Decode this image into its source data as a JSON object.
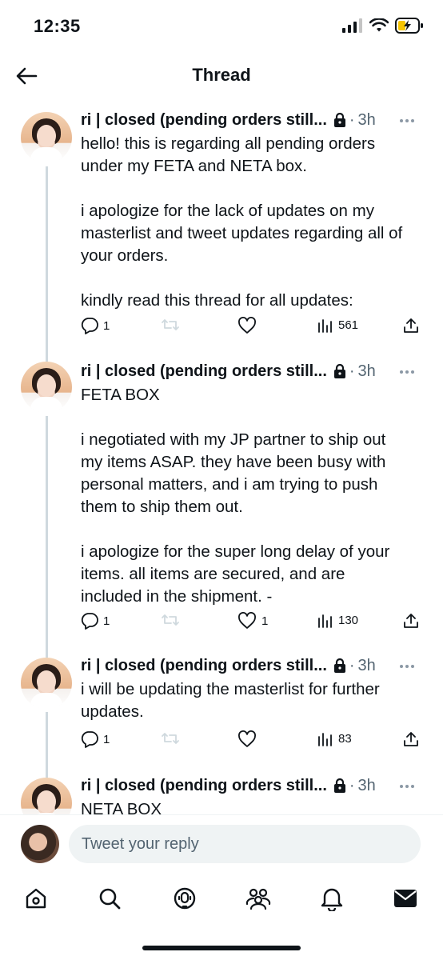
{
  "status_bar": {
    "time": "12:35"
  },
  "header": {
    "title": "Thread"
  },
  "tweets": [
    {
      "author": "ri | closed (pending orders still...",
      "time": "3h",
      "text": "hello! this is regarding all pending orders\nunder my FETA and NETA box.\n\ni apologize for the lack of updates on my\nmasterlist and tweet updates regarding all of\nyour orders.\n\nkindly read this thread for all updates:",
      "replies": "1",
      "retweets": "",
      "likes": "",
      "views": "561"
    },
    {
      "author": "ri | closed (pending orders still...",
      "time": "3h",
      "text": "FETA BOX\n\ni negotiated with my JP partner to ship out\nmy items ASAP. they have been busy with\npersonal matters, and i am trying to push\nthem to ship them out.\n\ni apologize for the super long delay of your\nitems. all items are secured, and are\nincluded in the shipment. -",
      "replies": "1",
      "retweets": "",
      "likes": "1",
      "views": "130"
    },
    {
      "author": "ri | closed (pending orders still...",
      "time": "3h",
      "text": "i will be updating the masterlist for further\nupdates.",
      "replies": "1",
      "retweets": "",
      "likes": "",
      "views": "83"
    },
    {
      "author": "ri | closed (pending orders still...",
      "time": "3h",
      "text": "NETA BOX"
    }
  ],
  "reply_bar": {
    "placeholder": "Tweet your reply"
  },
  "tab_bar": {
    "items": [
      "home-icon",
      "search-icon",
      "spaces-icon",
      "communities-icon",
      "notifications-icon",
      "messages-icon"
    ]
  },
  "colors": {
    "text": "#0f1419",
    "muted": "#536471",
    "line": "#cfd9de",
    "input_bg": "#eff3f4"
  }
}
